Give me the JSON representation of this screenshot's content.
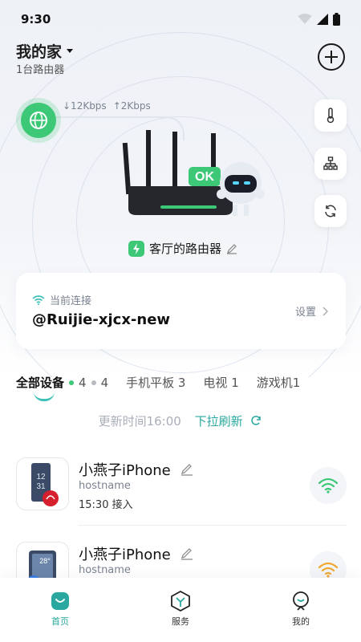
{
  "status_bar": {
    "time": "9:30"
  },
  "header": {
    "home_name": "我的家",
    "router_count": "1台路由器"
  },
  "speed": {
    "down": "↓12Kbps",
    "up": "↑2Kbps"
  },
  "router": {
    "name": "客厅的路由器",
    "badge": "OK"
  },
  "connection": {
    "label": "当前连接",
    "ssid": "@Ruijie-xjcx-new",
    "settings": "设置"
  },
  "tabs": [
    {
      "label": "全部设备",
      "online": "4",
      "offline": "4"
    },
    {
      "label": "手机平板 3"
    },
    {
      "label": "电视 1"
    },
    {
      "label": "游戏机1"
    }
  ],
  "update": {
    "time_text": "更新时间16:00",
    "refresh_text": "下拉刷新"
  },
  "devices": [
    {
      "name": "小燕子iPhone",
      "host": "hostname",
      "time": "15:30 接入",
      "thumb_text": "12\n31",
      "thumb_badge": "HUAWEI",
      "wifi_color": "#3cc876"
    },
    {
      "name": "小燕子iPhone",
      "host": "hostname",
      "time": "",
      "thumb_text": "28°",
      "thumb_badge": "",
      "wifi_color": "#f0a830"
    }
  ],
  "nav": {
    "home": "首页",
    "service": "服务",
    "mine": "我的"
  },
  "colors": {
    "accent": "#2aa8a0",
    "online": "#3cc876"
  }
}
